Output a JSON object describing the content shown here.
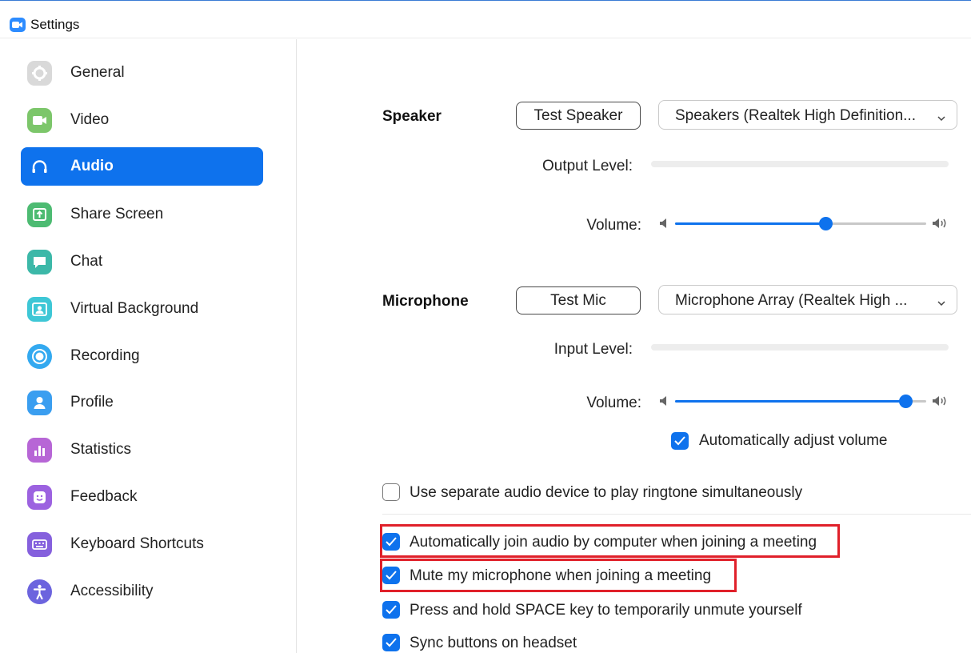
{
  "window": {
    "title": "Settings"
  },
  "sidebar": {
    "items": [
      {
        "label": "General",
        "icon": "gear-icon",
        "color": "#d9d9d9"
      },
      {
        "label": "Video",
        "icon": "video-camera-icon",
        "color": "#7cc66a"
      },
      {
        "label": "Audio",
        "icon": "headphones-icon",
        "color": "#0e72ed",
        "active": true
      },
      {
        "label": "Share Screen",
        "icon": "share-screen-icon",
        "color": "#4dbb72"
      },
      {
        "label": "Chat",
        "icon": "chat-bubble-icon",
        "color": "#3cb8a8"
      },
      {
        "label": "Virtual Background",
        "icon": "person-background-icon",
        "color": "#3ec7d6"
      },
      {
        "label": "Recording",
        "icon": "record-icon",
        "color": "#33a9f0"
      },
      {
        "label": "Profile",
        "icon": "profile-icon",
        "color": "#3a9ef0"
      },
      {
        "label": "Statistics",
        "icon": "bar-chart-icon",
        "color": "#b766d6"
      },
      {
        "label": "Feedback",
        "icon": "smiley-icon",
        "color": "#9c62e0"
      },
      {
        "label": "Keyboard Shortcuts",
        "icon": "keyboard-icon",
        "color": "#8560dd"
      },
      {
        "label": "Accessibility",
        "icon": "accessibility-icon",
        "color": "#6c64de"
      }
    ]
  },
  "speaker": {
    "label": "Speaker",
    "test_button": "Test Speaker",
    "device": "Speakers (Realtek High Definition...",
    "output_level_label": "Output Level:",
    "output_level": 0,
    "volume_label": "Volume:",
    "volume": 0.6
  },
  "microphone": {
    "label": "Microphone",
    "test_button": "Test Mic",
    "device": "Microphone Array (Realtek High ...",
    "input_level_label": "Input Level:",
    "input_level": 0,
    "volume_label": "Volume:",
    "volume": 0.92,
    "auto_adjust_label": "Automatically adjust volume",
    "auto_adjust": true
  },
  "options": [
    {
      "label": "Use separate audio device to play ringtone simultaneously",
      "checked": false
    },
    {
      "label": "Automatically join audio by computer when joining a meeting",
      "checked": true,
      "highlighted": true
    },
    {
      "label": "Mute my microphone when joining a meeting",
      "checked": true,
      "highlighted": true
    },
    {
      "label": "Press and hold SPACE key to temporarily unmute yourself",
      "checked": true
    },
    {
      "label": "Sync buttons on headset",
      "checked": true
    }
  ],
  "colors": {
    "accent": "#0e72ed",
    "highlight": "#e0202a"
  }
}
